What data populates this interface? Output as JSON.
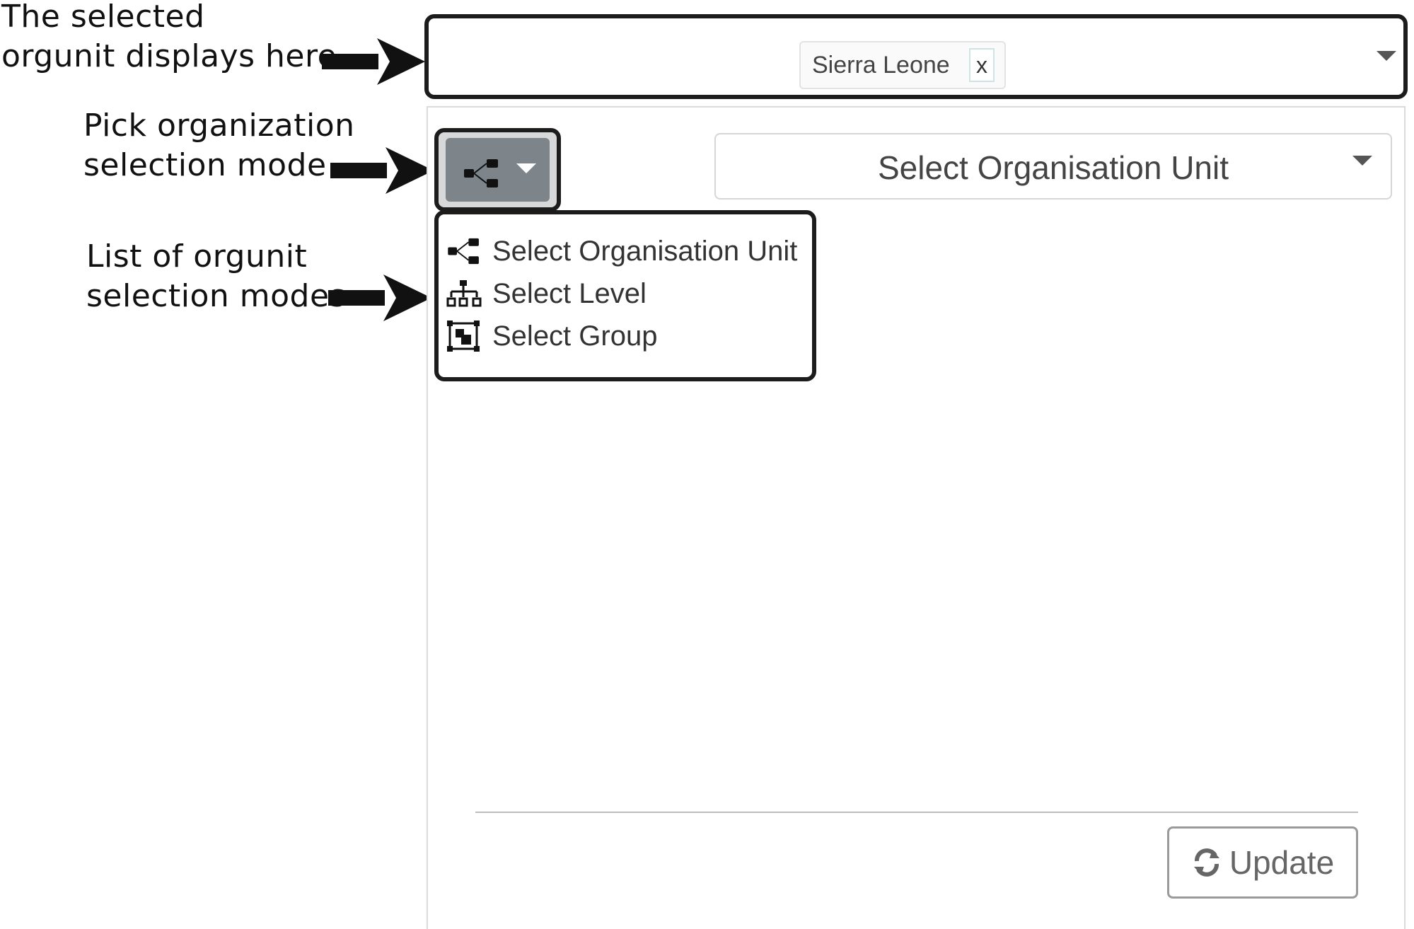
{
  "annotations": {
    "selected_display": [
      "The selected",
      "orgunit displays here"
    ],
    "pick_mode": [
      "Pick organization",
      "selection mode"
    ],
    "mode_list": [
      "List of orgunit",
      "selection modes"
    ]
  },
  "selection": {
    "chip_label": "Sierra Leone",
    "chip_remove": "x"
  },
  "org_select": {
    "placeholder": "Select Organisation Unit"
  },
  "modes": [
    {
      "label": "Select Organisation Unit",
      "icon": "orgunit-tree-icon"
    },
    {
      "label": "Select Level",
      "icon": "level-hierarchy-icon"
    },
    {
      "label": "Select Group",
      "icon": "group-icon"
    }
  ],
  "footer": {
    "update_label": "Update",
    "update_icon": "refresh-icon"
  },
  "colors": {
    "mode_button_bg": "#7d858b",
    "annotation_outline": "#1c1c1c"
  }
}
